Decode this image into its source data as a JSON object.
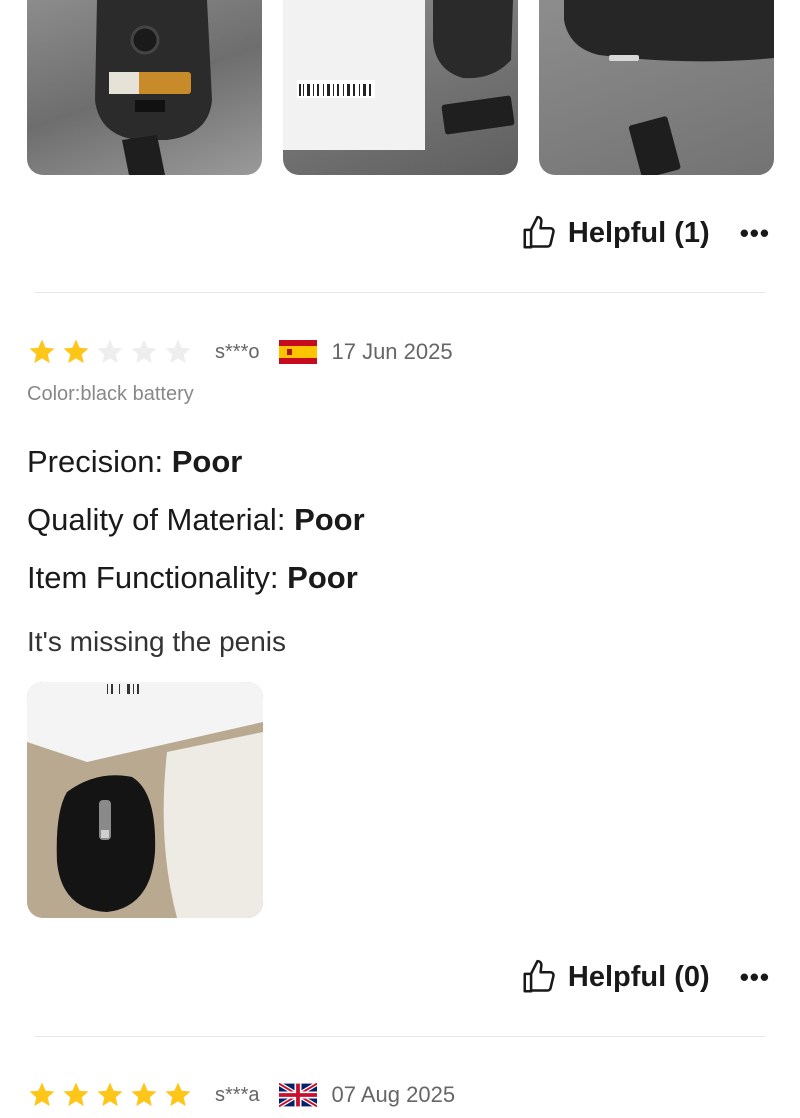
{
  "review_1": {
    "helpful_label": "Helpful (1)",
    "more_label": "•••"
  },
  "review_2": {
    "rating": 2,
    "max_rating": 5,
    "reviewer": "s***o",
    "country_flag": "spain-flag",
    "date": "17 Jun 2025",
    "variant": "Color:black battery",
    "attributes": [
      {
        "label": "Precision:",
        "value": "Poor"
      },
      {
        "label": "Quality of Material:",
        "value": "Poor"
      },
      {
        "label": "Item Functionality:",
        "value": "Poor"
      }
    ],
    "comment": "It's missing the penis",
    "helpful_label": "Helpful (0)",
    "more_label": "•••"
  },
  "review_3": {
    "rating": 5,
    "max_rating": 5,
    "reviewer": "s***a",
    "country_flag": "uk-flag",
    "date": "07 Aug 2025"
  },
  "colors": {
    "star_filled": "#FFC61A",
    "star_empty": "#EEEEEE",
    "divider": "#E6E6E6",
    "muted_text": "#666666"
  }
}
